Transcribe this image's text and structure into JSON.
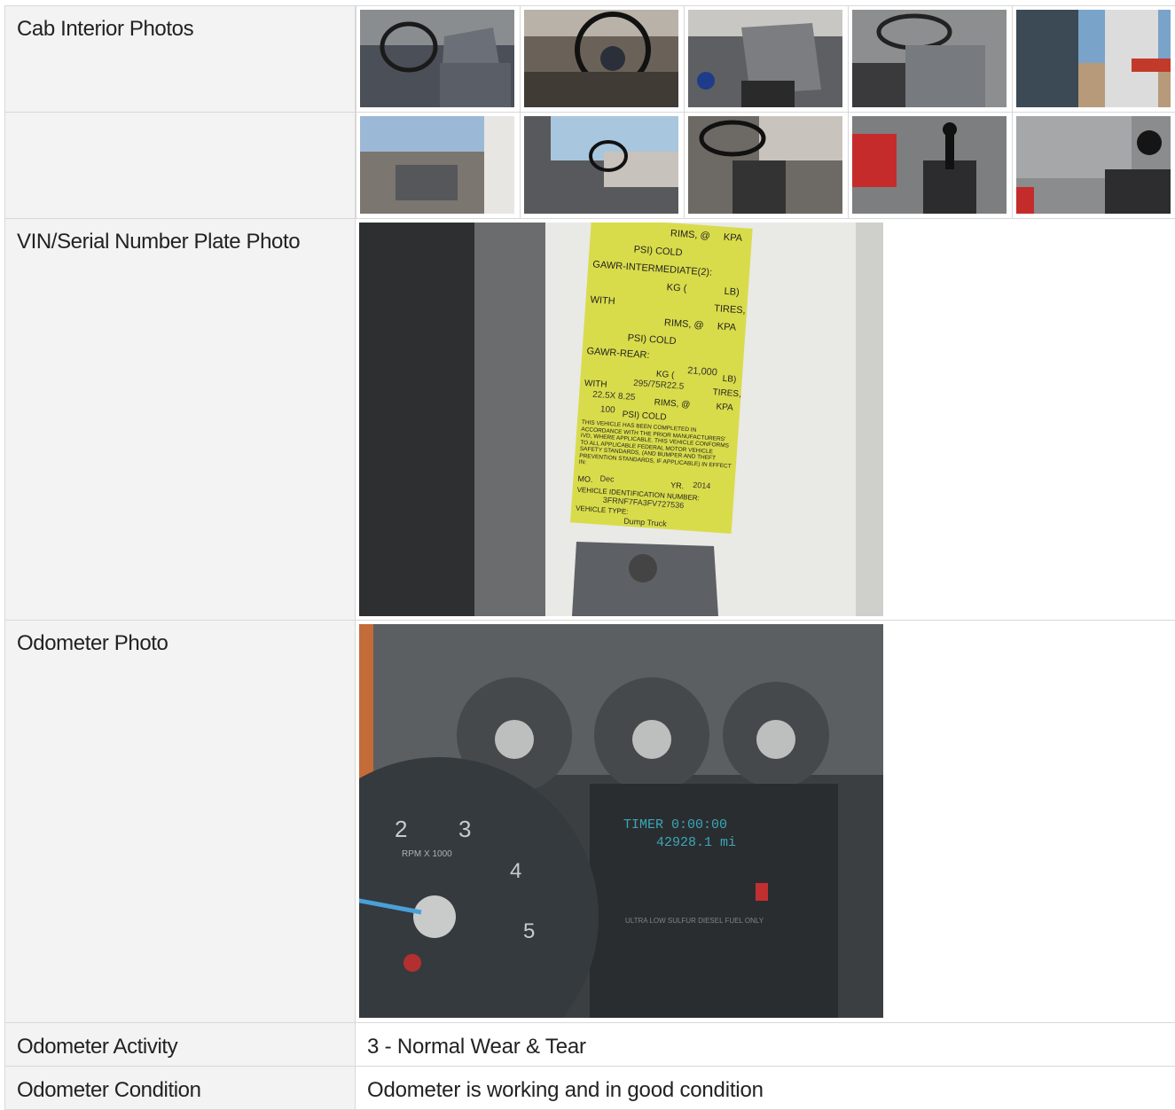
{
  "labels": {
    "cab_interior": "Cab Interior Photos",
    "vin_plate": "VIN/Serial Number Plate Photo",
    "odometer_photo": "Odometer Photo",
    "odometer_activity": "Odometer Activity",
    "odometer_condition": "Odometer Condition"
  },
  "values": {
    "odometer_activity": "3 - Normal Wear & Tear",
    "odometer_condition": "Odometer is working and in good condition"
  },
  "vin_plate": {
    "l1": "RIMS, @",
    "l1b": "KPA",
    "l2": "PSI) COLD",
    "l3": "GAWR-INTERMEDIATE(2):",
    "l4": "KG (",
    "l4b": "LB)",
    "l5": "WITH",
    "l5b": "TIRES,",
    "l6": "RIMS, @",
    "l6b": "KPA",
    "l7": "PSI) COLD",
    "l8": "GAWR-REAR:",
    "rear_lb": "21,000",
    "kg": "KG (",
    "lb": "LB)",
    "tires": "295/75R22.5",
    "with": "WITH",
    "tires_word": "TIRES,",
    "rims_size": "22.5X 8.25",
    "rims": "RIMS, @",
    "kpa": "KPA",
    "psi": "100",
    "psi_cold": "PSI) COLD",
    "compliance": "THIS VEHICLE HAS BEEN COMPLETED IN ACCORDANCE WITH THE PRIOR MANUFACTURERS' IVD, WHERE APPLICABLE. THIS VEHICLE CONFORMS TO ALL APPLICABLE FEDERAL MOTOR VEHICLE SAFETY STANDARDS, (AND BUMPER AND THEFT PREVENTION STANDARDS, IF APPLICABLE) IN EFFECT IN:",
    "mo_label": "MO.",
    "mo": "Dec",
    "yr_label": "YR.",
    "yr": "2014",
    "vin_label": "VEHICLE IDENTIFICATION NUMBER:",
    "vin": "3FRNF7FA3FV727536",
    "type_label": "VEHICLE TYPE:",
    "type": "Dump Truck"
  },
  "odometer": {
    "timer": "TIMER 0:00:00",
    "mileage": "42928.1 mi",
    "tach_2": "2",
    "tach_3": "3",
    "tach_4": "4",
    "tach_5": "5",
    "rpm": "RPM X 1000",
    "fuel_note": "ULTRA LOW SULFUR DIESEL FUEL ONLY"
  },
  "colors": {
    "label_bg": "#f3f3f3",
    "border": "#d8d8d8",
    "plate_yellow": "#d9dc4a"
  }
}
